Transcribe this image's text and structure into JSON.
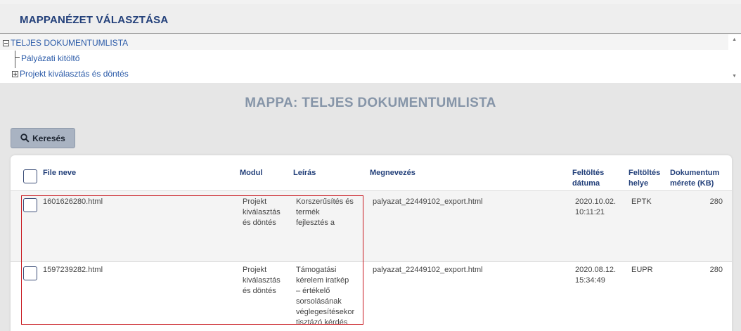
{
  "folder_panel": {
    "title": "MAPPANÉZET VÁLASZTÁSA",
    "tree": {
      "root": "TELJES DOKUMENTUMLISTA",
      "children": [
        "Pályázati kitöltő",
        "Projekt kiválasztás és döntés"
      ]
    }
  },
  "main_title": "MAPPA: TELJES DOKUMENTUMLISTA",
  "search_button": "Keresés",
  "table": {
    "headers": {
      "file": "File neve",
      "module": "Modul",
      "description": "Leírás",
      "name": "Megnevezés",
      "date_1": "Feltöltés",
      "date_2": "dátuma",
      "place_1": "Feltöltés",
      "place_2": "helye",
      "size_1": "Dokumentum",
      "size_2": "mérete (KB)"
    },
    "rows": [
      {
        "file": "1601626280.html",
        "module": [
          "Projekt",
          "kiválasztás",
          "és döntés"
        ],
        "description": [
          "Korszerűsítés és",
          "termék",
          "fejlesztés a"
        ],
        "name": "palyazat_22449102_export.html",
        "date": [
          "2020.10.02.",
          "10:11:21"
        ],
        "place": "EPTK",
        "size": "280"
      },
      {
        "file": "1597239282.html",
        "module": [
          "Projekt",
          "kiválasztás",
          "és döntés"
        ],
        "description": [
          "Támogatási",
          "kérelem iratkép",
          "– értékelő",
          "sorsolásának",
          "véglegesítésekor",
          "tisztázó kérdés"
        ],
        "name": "palyazat_22449102_export.html",
        "date": [
          "2020.08.12.",
          "15:34:49"
        ],
        "place": "EUPR",
        "size": "280"
      }
    ]
  }
}
